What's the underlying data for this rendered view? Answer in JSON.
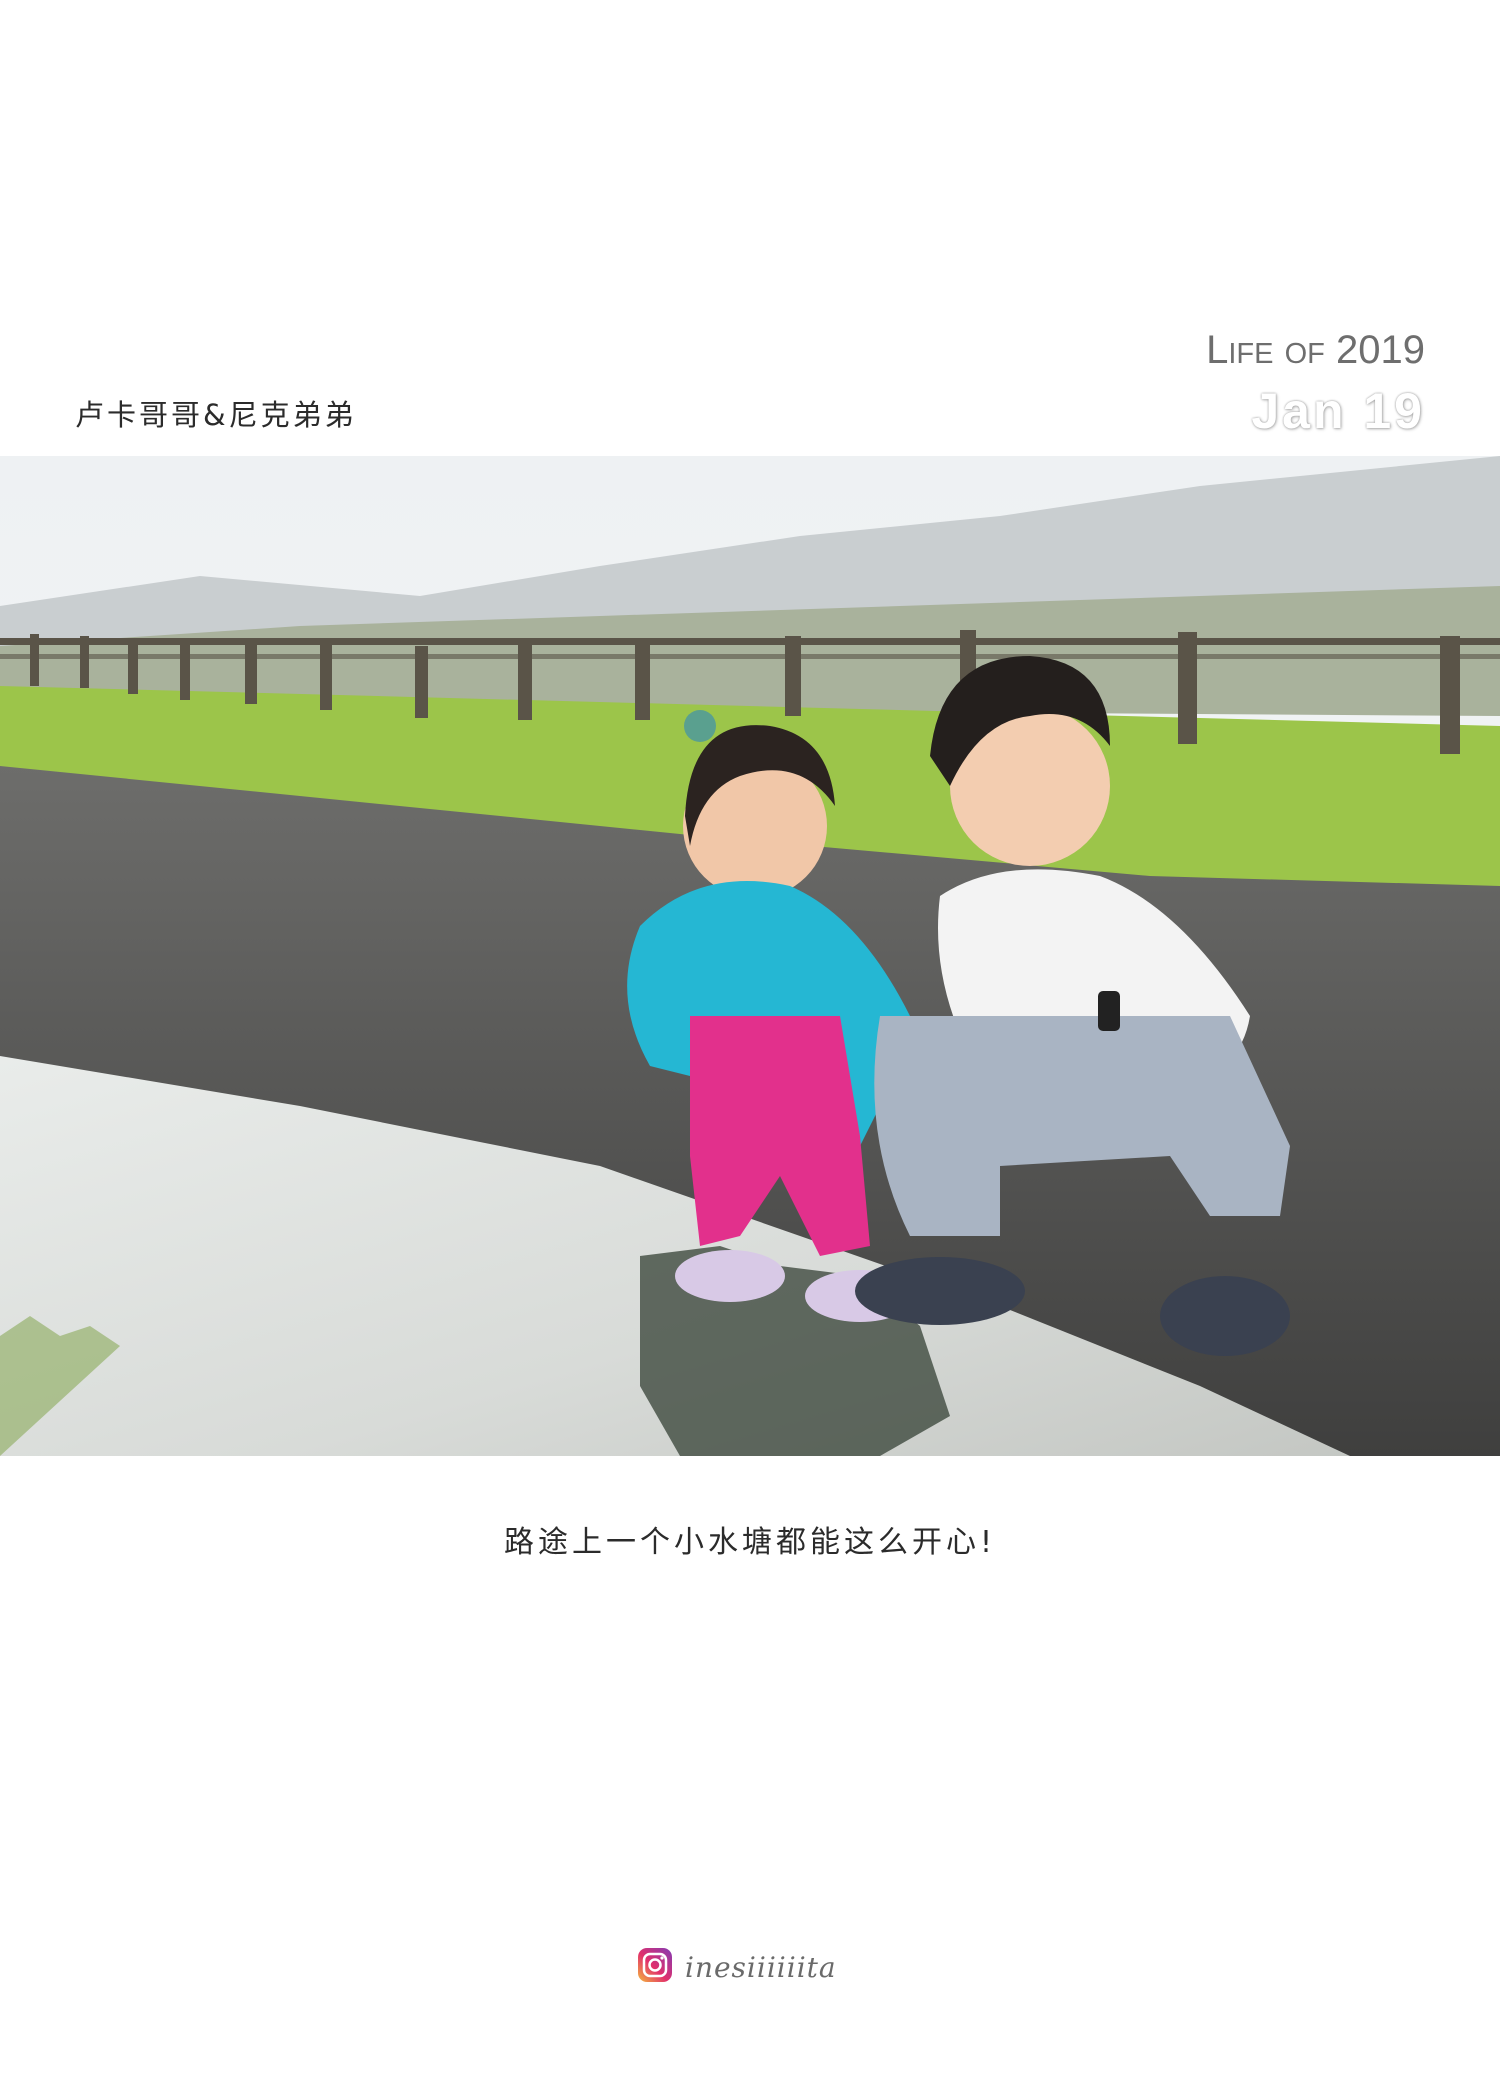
{
  "header": {
    "names": "卢卡哥哥&尼克弟弟",
    "life_L": "L",
    "life_ife": "IFE",
    "life_of": "OF",
    "life_year": "2019",
    "date": "Jan 19"
  },
  "photo": {
    "scene": "two-children-squatting-by-puddle"
  },
  "caption": "路途上一个小水塘都能这么开心!",
  "footer": {
    "icon": "instagram-icon",
    "handle": "inesiiiiiita"
  }
}
